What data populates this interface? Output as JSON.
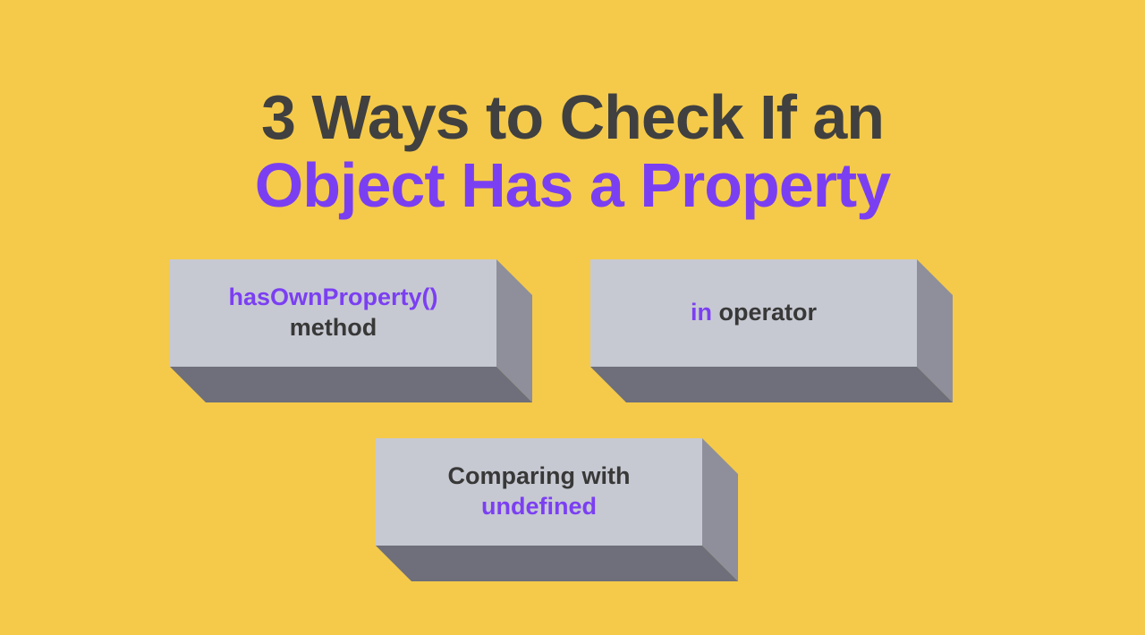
{
  "title": {
    "line1": "3 Ways to Check If an",
    "line2": "Object Has a Property"
  },
  "blocks": [
    {
      "purple": "hasOwnProperty()",
      "dark": "method"
    },
    {
      "purple": "in",
      "dark": " operator"
    },
    {
      "pre": "Comparing with",
      "purple": "undefined"
    }
  ],
  "colors": {
    "background": "#f5ca4a",
    "accent": "#7b3ff2",
    "dark_text": "#404040",
    "block_face": "#c7c9d2",
    "block_side": "#8e8f9b",
    "block_bottom": "#6e6f7a"
  }
}
